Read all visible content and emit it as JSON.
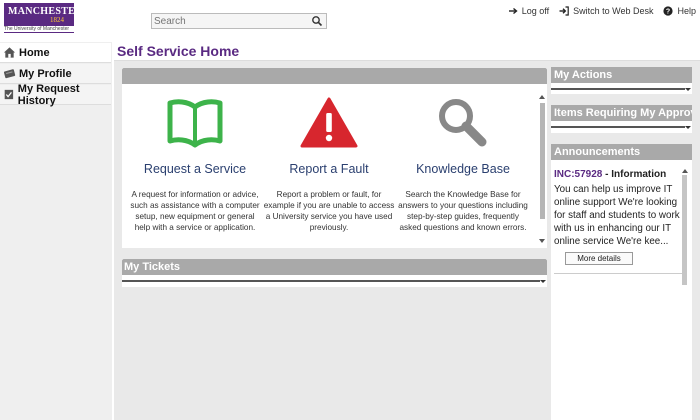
{
  "header": {
    "logo_line1": "MANCHESTER",
    "logo_line2": "1824",
    "logo_sub": "The University of Manchester",
    "search_placeholder": "Search",
    "links": [
      {
        "label": "Log off",
        "icon": "logoff-icon"
      },
      {
        "label": "Switch to Web Desk",
        "icon": "switch-icon"
      },
      {
        "label": "Help",
        "icon": "help-icon"
      }
    ]
  },
  "leftnav": {
    "items": [
      {
        "label": "Home",
        "icon": "home-icon"
      },
      {
        "label": "My Profile",
        "icon": "profile-icon"
      },
      {
        "label": "My Request History",
        "icon": "history-icon"
      }
    ]
  },
  "main": {
    "title": "Self Service Home",
    "tiles": [
      {
        "title": "Request a Service",
        "description": "A request for information or advice, such as assistance with a computer setup, new equipment or general help with a service or application.",
        "icon": "book-icon",
        "color": "#3db34a"
      },
      {
        "title": "Report a Fault",
        "description": "Report a problem or fault, for example if you are unable to access a University service you have used previously.",
        "icon": "warning-icon",
        "color": "#d7262e"
      },
      {
        "title": "Knowledge Base",
        "description": "Search the Knowledge Base for answers to your questions including step-by-step guides, frequently asked questions and known errors.",
        "icon": "magnifier-icon",
        "color": "#888888"
      }
    ],
    "tickets_title": "My Tickets"
  },
  "right": {
    "actions_title": "My Actions",
    "approval_title": "Items Requiring My Approval",
    "announcements_title": "Announcements",
    "announcement": {
      "id": "INC:57928",
      "sep": " - ",
      "type": "Information",
      "text": "You can help us improve IT online support  We're looking for staff and students to work with us in enhancing our IT online service We're kee...",
      "more_label": "More details"
    }
  },
  "colors": {
    "brand": "#5a2a82",
    "panel_bar": "#a9a9a9"
  }
}
